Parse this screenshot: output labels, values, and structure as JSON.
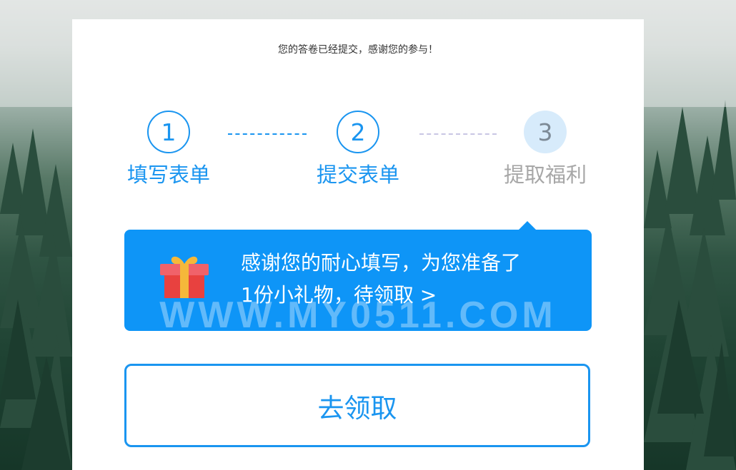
{
  "notice": {
    "text": "您的答卷已经提交，感谢您的参与！"
  },
  "steps": [
    {
      "number": "1",
      "label": "填写表单",
      "status": "done"
    },
    {
      "number": "2",
      "label": "提交表单",
      "status": "done"
    },
    {
      "number": "3",
      "label": "提取福利",
      "status": "current"
    }
  ],
  "gift_banner": {
    "line1": "感谢您的耐心填写，为您准备了",
    "line2": "1份小礼物，待领取 >",
    "icon": "gift-icon",
    "watermark": "WWW.MY0511.COM"
  },
  "claim_button": {
    "label": "去领取"
  },
  "colors": {
    "accent": "#1a95f0",
    "banner": "#0e95f7",
    "pending_step_bg": "#d7ebfb",
    "pending_text": "#a7a7a7"
  }
}
